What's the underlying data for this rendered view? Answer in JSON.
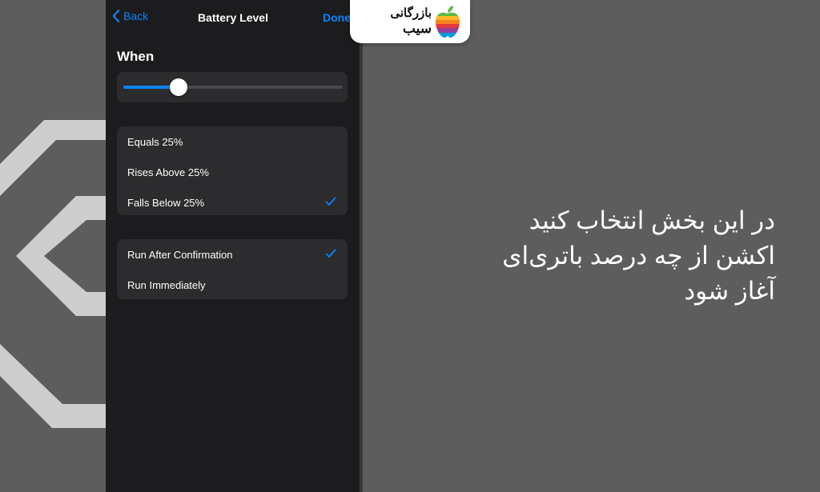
{
  "nav": {
    "back_label": "Back",
    "title": "Battery Level",
    "done_label": "Done"
  },
  "section": {
    "when_title": "When"
  },
  "slider": {
    "value_percent": 25
  },
  "condition_options": [
    {
      "label": "Equals 25%",
      "checked": false
    },
    {
      "label": "Rises Above 25%",
      "checked": false
    },
    {
      "label": "Falls Below 25%",
      "checked": true
    }
  ],
  "run_options": [
    {
      "label": "Run After Confirmation",
      "checked": true
    },
    {
      "label": "Run Immediately",
      "checked": false
    }
  ],
  "logo": {
    "line1": "بازرگانی",
    "line2": "سیب"
  },
  "caption": {
    "line1": "در این بخش انتخاب کنید",
    "line2": "اکشن از چه درصد باتری‌ای",
    "line3": "آغاز شود"
  },
  "colors": {
    "accent": "#0a84ff",
    "phone_bg": "#1c1c1e",
    "card_bg": "#2c2c2e",
    "page_bg": "#5e5d5e"
  }
}
